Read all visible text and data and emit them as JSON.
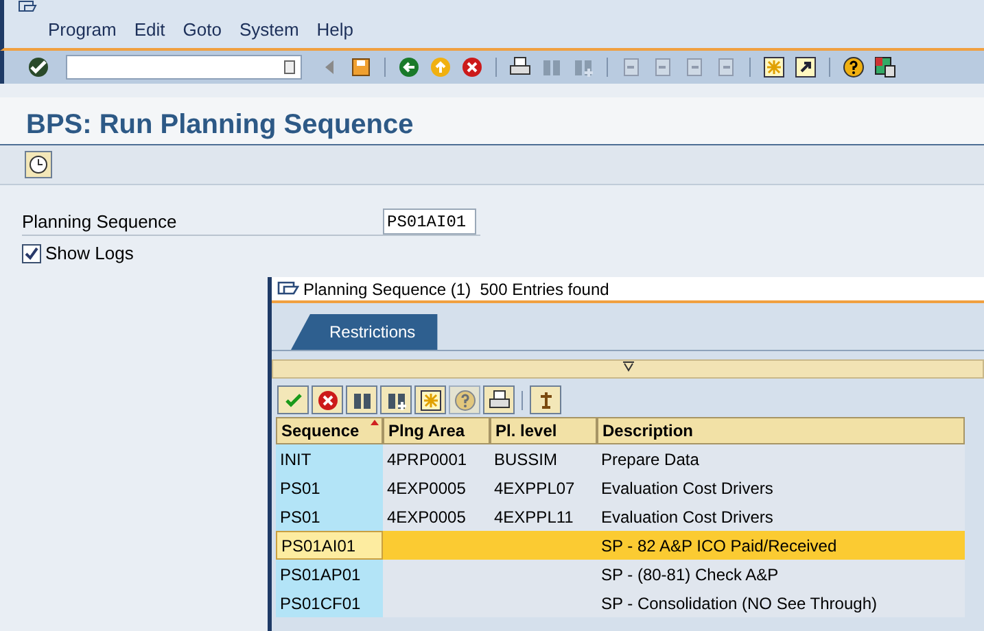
{
  "menu": [
    {
      "label": "Program"
    },
    {
      "label": "Edit"
    },
    {
      "label": "Goto"
    },
    {
      "label": "System"
    },
    {
      "label": "Help"
    }
  ],
  "toolbar": [
    {
      "kind": "enter",
      "disabled": false
    },
    {
      "kind": "command"
    },
    {
      "kind": "collapse",
      "disabled": false
    },
    {
      "kind": "save",
      "disabled": false
    },
    {
      "kind": "separator"
    },
    {
      "kind": "back",
      "disabled": false
    },
    {
      "kind": "exit",
      "disabled": false
    },
    {
      "kind": "cancel",
      "disabled": false
    },
    {
      "kind": "separator"
    },
    {
      "kind": "print",
      "disabled": false
    },
    {
      "kind": "find",
      "disabled": true
    },
    {
      "kind": "find-next",
      "disabled": true
    },
    {
      "kind": "separator"
    },
    {
      "kind": "first-page",
      "disabled": true
    },
    {
      "kind": "prev-page",
      "disabled": true
    },
    {
      "kind": "next-page",
      "disabled": true
    },
    {
      "kind": "last-page",
      "disabled": true
    },
    {
      "kind": "separator"
    },
    {
      "kind": "new-session",
      "disabled": false
    },
    {
      "kind": "shortcut",
      "disabled": false
    },
    {
      "kind": "separator"
    },
    {
      "kind": "help",
      "disabled": false
    },
    {
      "kind": "layout",
      "disabled": false
    }
  ],
  "title": "BPS: Run Planning Sequence",
  "form": {
    "field_label": "Planning Sequence",
    "field_value": "PS01AI01",
    "checkbox_label": "Show Logs",
    "checked": true
  },
  "popup": {
    "title": "Planning Sequence (1)  500 Entries found",
    "tabs": [
      {
        "label": "Restrictions",
        "selected": true
      }
    ],
    "grid_toolbar": [
      {
        "kind": "check",
        "disabled": false
      },
      {
        "kind": "cancel",
        "disabled": false
      },
      {
        "kind": "find",
        "disabled": false
      },
      {
        "kind": "find-next",
        "disabled": false
      },
      {
        "kind": "new",
        "disabled": false
      },
      {
        "kind": "help",
        "disabled": true
      },
      {
        "kind": "print",
        "disabled": false
      },
      {
        "kind": "separator"
      },
      {
        "kind": "sort",
        "disabled": false
      }
    ],
    "columns": [
      {
        "label": "Sequence",
        "sorted": true
      },
      {
        "label": "Plng Area",
        "sorted": false
      },
      {
        "label": "Pl. level",
        "sorted": false
      },
      {
        "label": "Description",
        "sorted": false
      }
    ],
    "rows": [
      {
        "cells": [
          "INIT",
          "4PRP0001",
          "BUSSIM",
          "Prepare Data"
        ],
        "selected": false
      },
      {
        "cells": [
          "PS01",
          "4EXP0005",
          "4EXPPL07",
          "Evaluation Cost Drivers"
        ],
        "selected": false
      },
      {
        "cells": [
          "PS01",
          "4EXP0005",
          "4EXPPL11",
          "Evaluation Cost Drivers"
        ],
        "selected": false
      },
      {
        "cells": [
          "PS01AI01",
          "",
          "",
          "SP - 82 A&P ICO Paid/Received"
        ],
        "selected": true
      },
      {
        "cells": [
          "PS01AP01",
          "",
          "",
          "SP - (80-81) Check A&P"
        ],
        "selected": false
      },
      {
        "cells": [
          "PS01CF01",
          "",
          "",
          "SP - Consolidation (NO See Through)"
        ],
        "selected": false
      }
    ]
  }
}
